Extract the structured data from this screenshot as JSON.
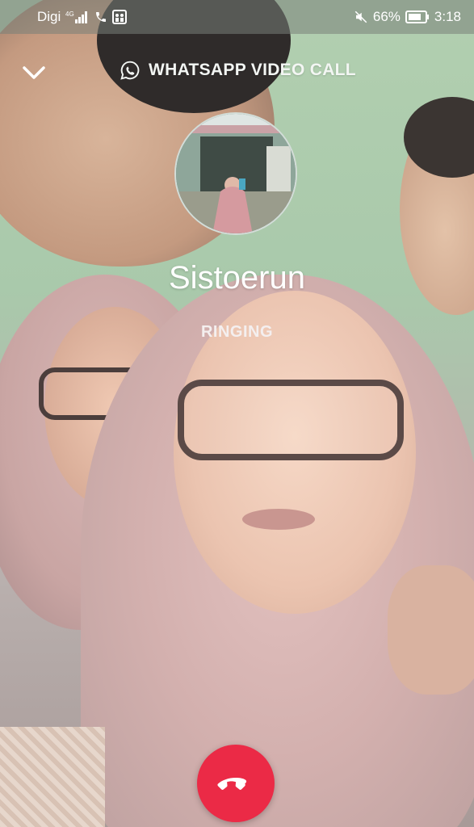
{
  "status_bar": {
    "carrier": "Digi",
    "network": "4G",
    "battery_percent": "66%",
    "time": "3:18"
  },
  "call": {
    "type_label": "WHATSAPP VIDEO CALL",
    "contact_name": "Sistoerun",
    "status": "RINGING"
  },
  "icons": {
    "signal": "signal-bars-icon",
    "call_indicator": "phone-call-icon",
    "sim": "sim-card-icon",
    "mute": "speaker-muted-icon",
    "battery": "battery-icon",
    "collapse": "chevron-down-icon",
    "whatsapp": "whatsapp-logo-icon",
    "end_call": "end-call-icon"
  },
  "colors": {
    "end_call": "#eb2a46",
    "text": "#ffffff"
  }
}
